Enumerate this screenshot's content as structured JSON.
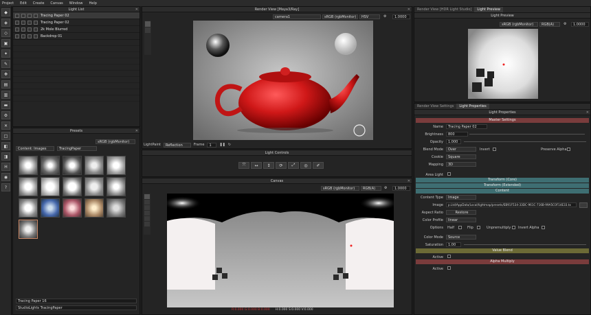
{
  "menu": [
    "Project",
    "Edit",
    "Create",
    "Canvas",
    "Window",
    "Help"
  ],
  "light_list": {
    "title": "Light List",
    "items": [
      "Tracing Paper 02",
      "Tracing Paper 02",
      "2k Mole Blurred",
      "Backdrop 01"
    ]
  },
  "presets": {
    "title": "Presets",
    "color_space": "sRGB (rgbMonitor)",
    "content_label": "Content: Images",
    "category": "TracingPaper",
    "selected_name": "Tracing Paper 16",
    "selected_path": "StudioLights TracingPaper"
  },
  "render_view": {
    "title": "Render View [Maya3/Ray]",
    "camera": "camera1",
    "color_space": "sRGB (rgbMonitor)",
    "mode": "HSV",
    "exposure": "1.0000",
    "lightpaint_label": "LightPaint",
    "lightpaint_mode": "Reflection",
    "frame_label": "Frame",
    "frame_value": "1"
  },
  "light_controls": {
    "title": "Light Controls"
  },
  "canvas": {
    "title": "Canvas",
    "color_space": "sRGB (rgbMonitor)",
    "channel": "RGB(A)",
    "status_rgb": "R:0.000 G:0.000 B:0.000",
    "status_hsv": "H:0.000 S:0.000 V:0.000"
  },
  "right_tabs": {
    "tab1": "Render View [HDR Light Studio]",
    "tab2": "Light Preview"
  },
  "light_preview": {
    "title": "Light Preview",
    "color_space": "sRGB (rgbMonitor)",
    "channel": "RGB(A)",
    "exposure": "1.0000"
  },
  "props_tabs": {
    "tab1": "Render View Settings",
    "tab2": "Light Properties"
  },
  "light_properties": {
    "title": "Light Properties",
    "master": "Master Settings",
    "name_label": "Name",
    "name": "Tracing Paper 02",
    "brightness_label": "Brightness",
    "brightness": "800",
    "opacity_label": "Opacity",
    "opacity": "1.000",
    "blend_label": "Blend Mode",
    "blend": "Over",
    "invert": "Invert",
    "preserve_alpha": "Preserve Alpha",
    "cookie_label": "Cookie",
    "cookie": "Square",
    "mapping_label": "Mapping",
    "mapping": "3D",
    "area_light": "Area Light",
    "transform_core": "Transform (Core)",
    "transform_ext": "Transform (Extended)",
    "content": "Content",
    "content_type_label": "Content Type",
    "content_type": "Image",
    "image_label": "Image",
    "image_path": "p.Ltd/AppData/Local/lightmap/presets/EB91F534-33DC-961C-716B-99A5C0F14E33.tx",
    "aspect_label": "Aspect Ratio",
    "restore": "Restore",
    "color_profile_label": "Color Profile",
    "color_profile": "linear",
    "options_label": "Options",
    "half": "Half",
    "flip": "Flip",
    "unpremultiply": "Unpremultiply",
    "invert_alpha": "Invert Alpha",
    "color_mode_label": "Color Mode",
    "color_mode": "Source",
    "saturation_label": "Saturation",
    "saturation": "1.00",
    "value_blend": "Value Blend",
    "active_label": "Active",
    "alpha_multiply": "Alpha Multiply",
    "active2_label": "Active"
  }
}
